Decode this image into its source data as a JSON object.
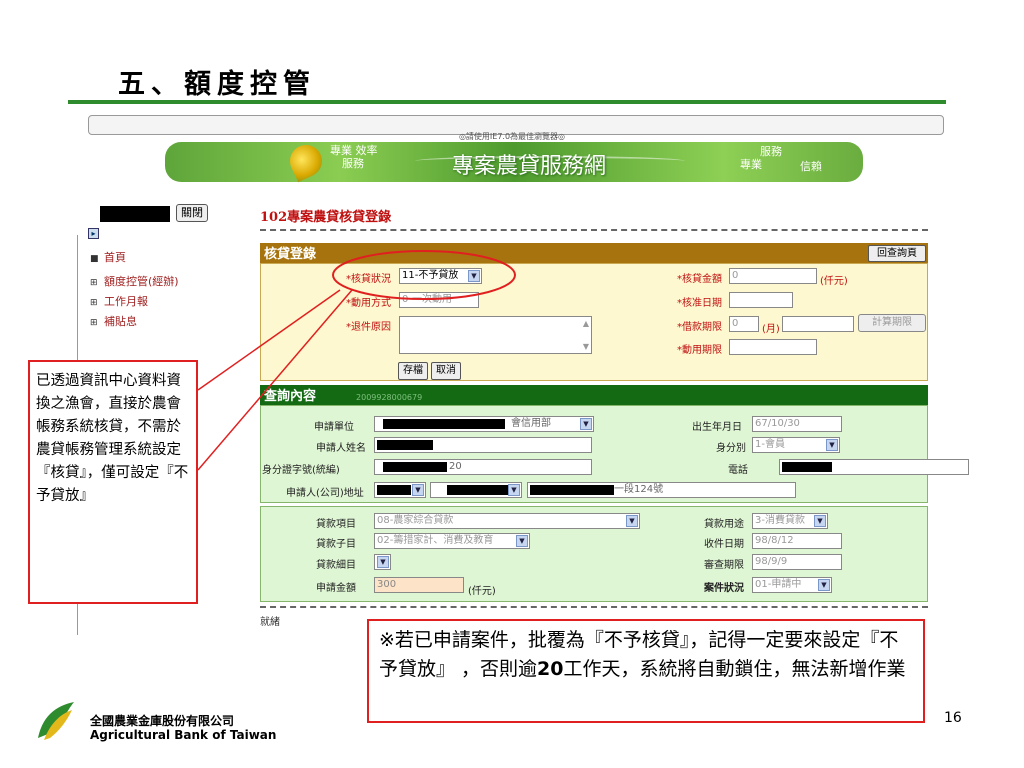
{
  "slide": {
    "title": "五、額度控管",
    "page_number": "16"
  },
  "browser": {
    "ie_note": "◎請使用IE7.0為最佳瀏覽器◎"
  },
  "banner": {
    "badge_line1": "專業 效率",
    "badge_line2": "服務",
    "title": "專案農貸服務網",
    "right_line1": "服務",
    "right_line2": "專業",
    "right_line3": "信賴"
  },
  "sidebar": {
    "close_label": "關閉",
    "items": [
      {
        "label": "首頁",
        "bullet": "■"
      },
      {
        "label": "額度控管(經辦)",
        "bullet": "⊞"
      },
      {
        "label": "工作月報",
        "bullet": "⊞"
      },
      {
        "label": "補貼息",
        "bullet": "⊞"
      }
    ]
  },
  "page": {
    "heading": "102專案農貸核貸登錄",
    "status": "就緒"
  },
  "approval": {
    "section_title": "核貸登錄",
    "back_button": "回查詢頁",
    "status_label": "*核貸狀況",
    "status_value": "11-不予貸放",
    "usage_label": "*動用方式",
    "usage_value": "0-一次動用",
    "return_reason_label": "*退件原因",
    "amount_label": "*核貸金額",
    "amount_value": "0",
    "amount_unit": "(仟元)",
    "approve_date_label": "*核准日期",
    "term_label": "*借款期限",
    "term_value": "0",
    "term_unit": "(月)",
    "calc_button": "計算期限",
    "use_term_label": "*動用期限",
    "save_button": "存檔",
    "cancel_button": "取消"
  },
  "query": {
    "section_title": "查詢內容",
    "case_no": "2009928000679",
    "unit_label": "申請單位",
    "unit_suffix": "會信用部",
    "name_label": "申請人姓名",
    "id_label": "身分證字號(統編)",
    "id_value_suffix": "20",
    "address_label": "申請人(公司)地址",
    "address_suffix": "一段124號",
    "birth_label": "出生年月日",
    "birth_value": "67/10/30",
    "identity_label": "身分別",
    "identity_value": "1-會員",
    "phone_label": "電話"
  },
  "loan": {
    "item_label": "貸款項目",
    "item_value": "08-農家綜合貸款",
    "subitem_label": "貸款子目",
    "subitem_value": "02-籌措家計、消費及教育",
    "detail_label": "貸款細目",
    "apply_amount_label": "申請金額",
    "apply_amount_value": "300",
    "apply_amount_unit": "(仟元)",
    "purpose_label": "貸款用途",
    "purpose_value": "3-消費貸款",
    "receive_date_label": "收件日期",
    "receive_date_value": "98/8/12",
    "review_date_label": "審查期限",
    "review_date_value": "98/9/9",
    "case_status_label": "案件狀況",
    "case_status_value": "01-申請中"
  },
  "callouts": {
    "left": "已透過資訊中心資料資換之漁會，直接於農會帳務系統核貸，不需於農貸帳務管理系統設定『核貸』，僅可設定『不予貸放』",
    "bottom_part1": "※若已申請案件，批覆為『不予核貸』，記得一定要來設定『不予貸放』 ，否則逾",
    "bottom_bold": "20",
    "bottom_part2": "工作天，系統將自動鎖住，無法新增作業"
  },
  "footer": {
    "bank_zh": "全國農業金庫股份有限公司",
    "bank_en": "Agricultural Bank of Taiwan"
  },
  "colors": {
    "green_rule": "#2e8b2e",
    "approval_header": "#a6730e",
    "query_header": "#136a13",
    "callout_border": "#e02020"
  }
}
